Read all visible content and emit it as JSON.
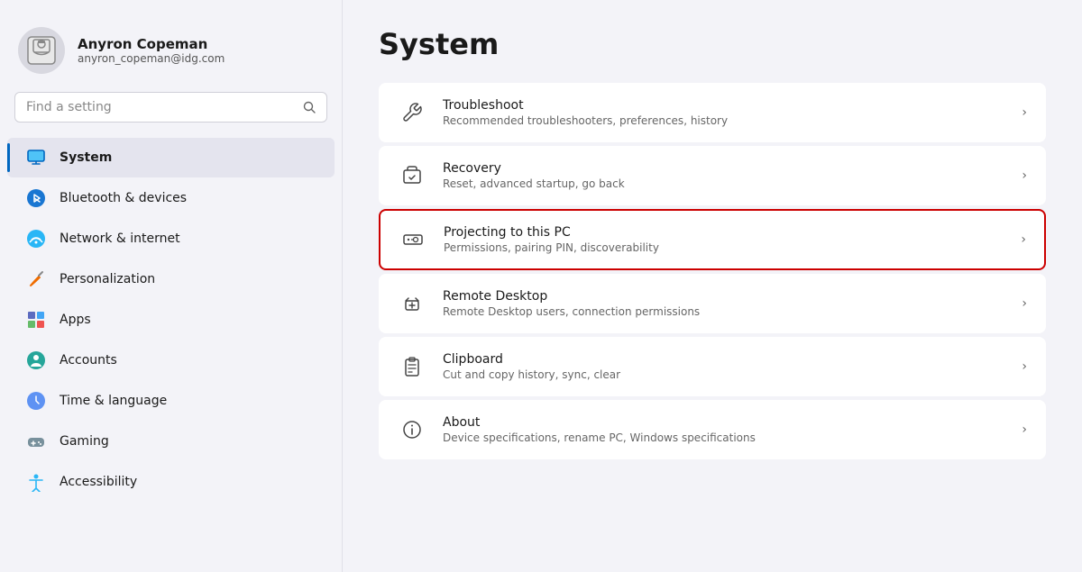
{
  "sidebar": {
    "user": {
      "name": "Anyron Copeman",
      "email": "anyron_copeman@idg.com"
    },
    "search": {
      "placeholder": "Find a setting"
    },
    "nav_items": [
      {
        "id": "system",
        "label": "System",
        "active": true,
        "icon": "monitor"
      },
      {
        "id": "bluetooth",
        "label": "Bluetooth & devices",
        "active": false,
        "icon": "bluetooth"
      },
      {
        "id": "network",
        "label": "Network & internet",
        "active": false,
        "icon": "network"
      },
      {
        "id": "personalization",
        "label": "Personalization",
        "active": false,
        "icon": "brush"
      },
      {
        "id": "apps",
        "label": "Apps",
        "active": false,
        "icon": "apps"
      },
      {
        "id": "accounts",
        "label": "Accounts",
        "active": false,
        "icon": "accounts"
      },
      {
        "id": "time",
        "label": "Time & language",
        "active": false,
        "icon": "time"
      },
      {
        "id": "gaming",
        "label": "Gaming",
        "active": false,
        "icon": "gaming"
      },
      {
        "id": "accessibility",
        "label": "Accessibility",
        "active": false,
        "icon": "accessibility"
      }
    ]
  },
  "main": {
    "title": "System",
    "settings": [
      {
        "id": "troubleshoot",
        "title": "Troubleshoot",
        "desc": "Recommended troubleshooters, preferences, history",
        "icon": "wrench",
        "highlighted": false
      },
      {
        "id": "recovery",
        "title": "Recovery",
        "desc": "Reset, advanced startup, go back",
        "icon": "recovery",
        "highlighted": false
      },
      {
        "id": "projecting",
        "title": "Projecting to this PC",
        "desc": "Permissions, pairing PIN, discoverability",
        "icon": "projector",
        "highlighted": true
      },
      {
        "id": "remote-desktop",
        "title": "Remote Desktop",
        "desc": "Remote Desktop users, connection permissions",
        "icon": "remote",
        "highlighted": false
      },
      {
        "id": "clipboard",
        "title": "Clipboard",
        "desc": "Cut and copy history, sync, clear",
        "icon": "clipboard",
        "highlighted": false
      },
      {
        "id": "about",
        "title": "About",
        "desc": "Device specifications, rename PC, Windows specifications",
        "icon": "info",
        "highlighted": false
      }
    ]
  }
}
